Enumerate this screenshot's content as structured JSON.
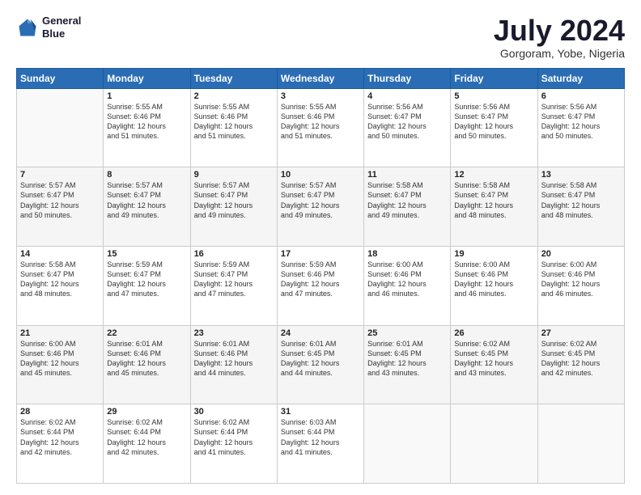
{
  "header": {
    "logo_line1": "General",
    "logo_line2": "Blue",
    "title": "July 2024",
    "subtitle": "Gorgoram, Yobe, Nigeria"
  },
  "weekdays": [
    "Sunday",
    "Monday",
    "Tuesday",
    "Wednesday",
    "Thursday",
    "Friday",
    "Saturday"
  ],
  "weeks": [
    [
      {
        "num": "",
        "info": ""
      },
      {
        "num": "1",
        "info": "Sunrise: 5:55 AM\nSunset: 6:46 PM\nDaylight: 12 hours\nand 51 minutes."
      },
      {
        "num": "2",
        "info": "Sunrise: 5:55 AM\nSunset: 6:46 PM\nDaylight: 12 hours\nand 51 minutes."
      },
      {
        "num": "3",
        "info": "Sunrise: 5:55 AM\nSunset: 6:46 PM\nDaylight: 12 hours\nand 51 minutes."
      },
      {
        "num": "4",
        "info": "Sunrise: 5:56 AM\nSunset: 6:47 PM\nDaylight: 12 hours\nand 50 minutes."
      },
      {
        "num": "5",
        "info": "Sunrise: 5:56 AM\nSunset: 6:47 PM\nDaylight: 12 hours\nand 50 minutes."
      },
      {
        "num": "6",
        "info": "Sunrise: 5:56 AM\nSunset: 6:47 PM\nDaylight: 12 hours\nand 50 minutes."
      }
    ],
    [
      {
        "num": "7",
        "info": "Sunrise: 5:57 AM\nSunset: 6:47 PM\nDaylight: 12 hours\nand 50 minutes."
      },
      {
        "num": "8",
        "info": "Sunrise: 5:57 AM\nSunset: 6:47 PM\nDaylight: 12 hours\nand 49 minutes."
      },
      {
        "num": "9",
        "info": "Sunrise: 5:57 AM\nSunset: 6:47 PM\nDaylight: 12 hours\nand 49 minutes."
      },
      {
        "num": "10",
        "info": "Sunrise: 5:57 AM\nSunset: 6:47 PM\nDaylight: 12 hours\nand 49 minutes."
      },
      {
        "num": "11",
        "info": "Sunrise: 5:58 AM\nSunset: 6:47 PM\nDaylight: 12 hours\nand 49 minutes."
      },
      {
        "num": "12",
        "info": "Sunrise: 5:58 AM\nSunset: 6:47 PM\nDaylight: 12 hours\nand 48 minutes."
      },
      {
        "num": "13",
        "info": "Sunrise: 5:58 AM\nSunset: 6:47 PM\nDaylight: 12 hours\nand 48 minutes."
      }
    ],
    [
      {
        "num": "14",
        "info": "Sunrise: 5:58 AM\nSunset: 6:47 PM\nDaylight: 12 hours\nand 48 minutes."
      },
      {
        "num": "15",
        "info": "Sunrise: 5:59 AM\nSunset: 6:47 PM\nDaylight: 12 hours\nand 47 minutes."
      },
      {
        "num": "16",
        "info": "Sunrise: 5:59 AM\nSunset: 6:47 PM\nDaylight: 12 hours\nand 47 minutes."
      },
      {
        "num": "17",
        "info": "Sunrise: 5:59 AM\nSunset: 6:46 PM\nDaylight: 12 hours\nand 47 minutes."
      },
      {
        "num": "18",
        "info": "Sunrise: 6:00 AM\nSunset: 6:46 PM\nDaylight: 12 hours\nand 46 minutes."
      },
      {
        "num": "19",
        "info": "Sunrise: 6:00 AM\nSunset: 6:46 PM\nDaylight: 12 hours\nand 46 minutes."
      },
      {
        "num": "20",
        "info": "Sunrise: 6:00 AM\nSunset: 6:46 PM\nDaylight: 12 hours\nand 46 minutes."
      }
    ],
    [
      {
        "num": "21",
        "info": "Sunrise: 6:00 AM\nSunset: 6:46 PM\nDaylight: 12 hours\nand 45 minutes."
      },
      {
        "num": "22",
        "info": "Sunrise: 6:01 AM\nSunset: 6:46 PM\nDaylight: 12 hours\nand 45 minutes."
      },
      {
        "num": "23",
        "info": "Sunrise: 6:01 AM\nSunset: 6:46 PM\nDaylight: 12 hours\nand 44 minutes."
      },
      {
        "num": "24",
        "info": "Sunrise: 6:01 AM\nSunset: 6:45 PM\nDaylight: 12 hours\nand 44 minutes."
      },
      {
        "num": "25",
        "info": "Sunrise: 6:01 AM\nSunset: 6:45 PM\nDaylight: 12 hours\nand 43 minutes."
      },
      {
        "num": "26",
        "info": "Sunrise: 6:02 AM\nSunset: 6:45 PM\nDaylight: 12 hours\nand 43 minutes."
      },
      {
        "num": "27",
        "info": "Sunrise: 6:02 AM\nSunset: 6:45 PM\nDaylight: 12 hours\nand 42 minutes."
      }
    ],
    [
      {
        "num": "28",
        "info": "Sunrise: 6:02 AM\nSunset: 6:44 PM\nDaylight: 12 hours\nand 42 minutes."
      },
      {
        "num": "29",
        "info": "Sunrise: 6:02 AM\nSunset: 6:44 PM\nDaylight: 12 hours\nand 42 minutes."
      },
      {
        "num": "30",
        "info": "Sunrise: 6:02 AM\nSunset: 6:44 PM\nDaylight: 12 hours\nand 41 minutes."
      },
      {
        "num": "31",
        "info": "Sunrise: 6:03 AM\nSunset: 6:44 PM\nDaylight: 12 hours\nand 41 minutes."
      },
      {
        "num": "",
        "info": ""
      },
      {
        "num": "",
        "info": ""
      },
      {
        "num": "",
        "info": ""
      }
    ]
  ]
}
